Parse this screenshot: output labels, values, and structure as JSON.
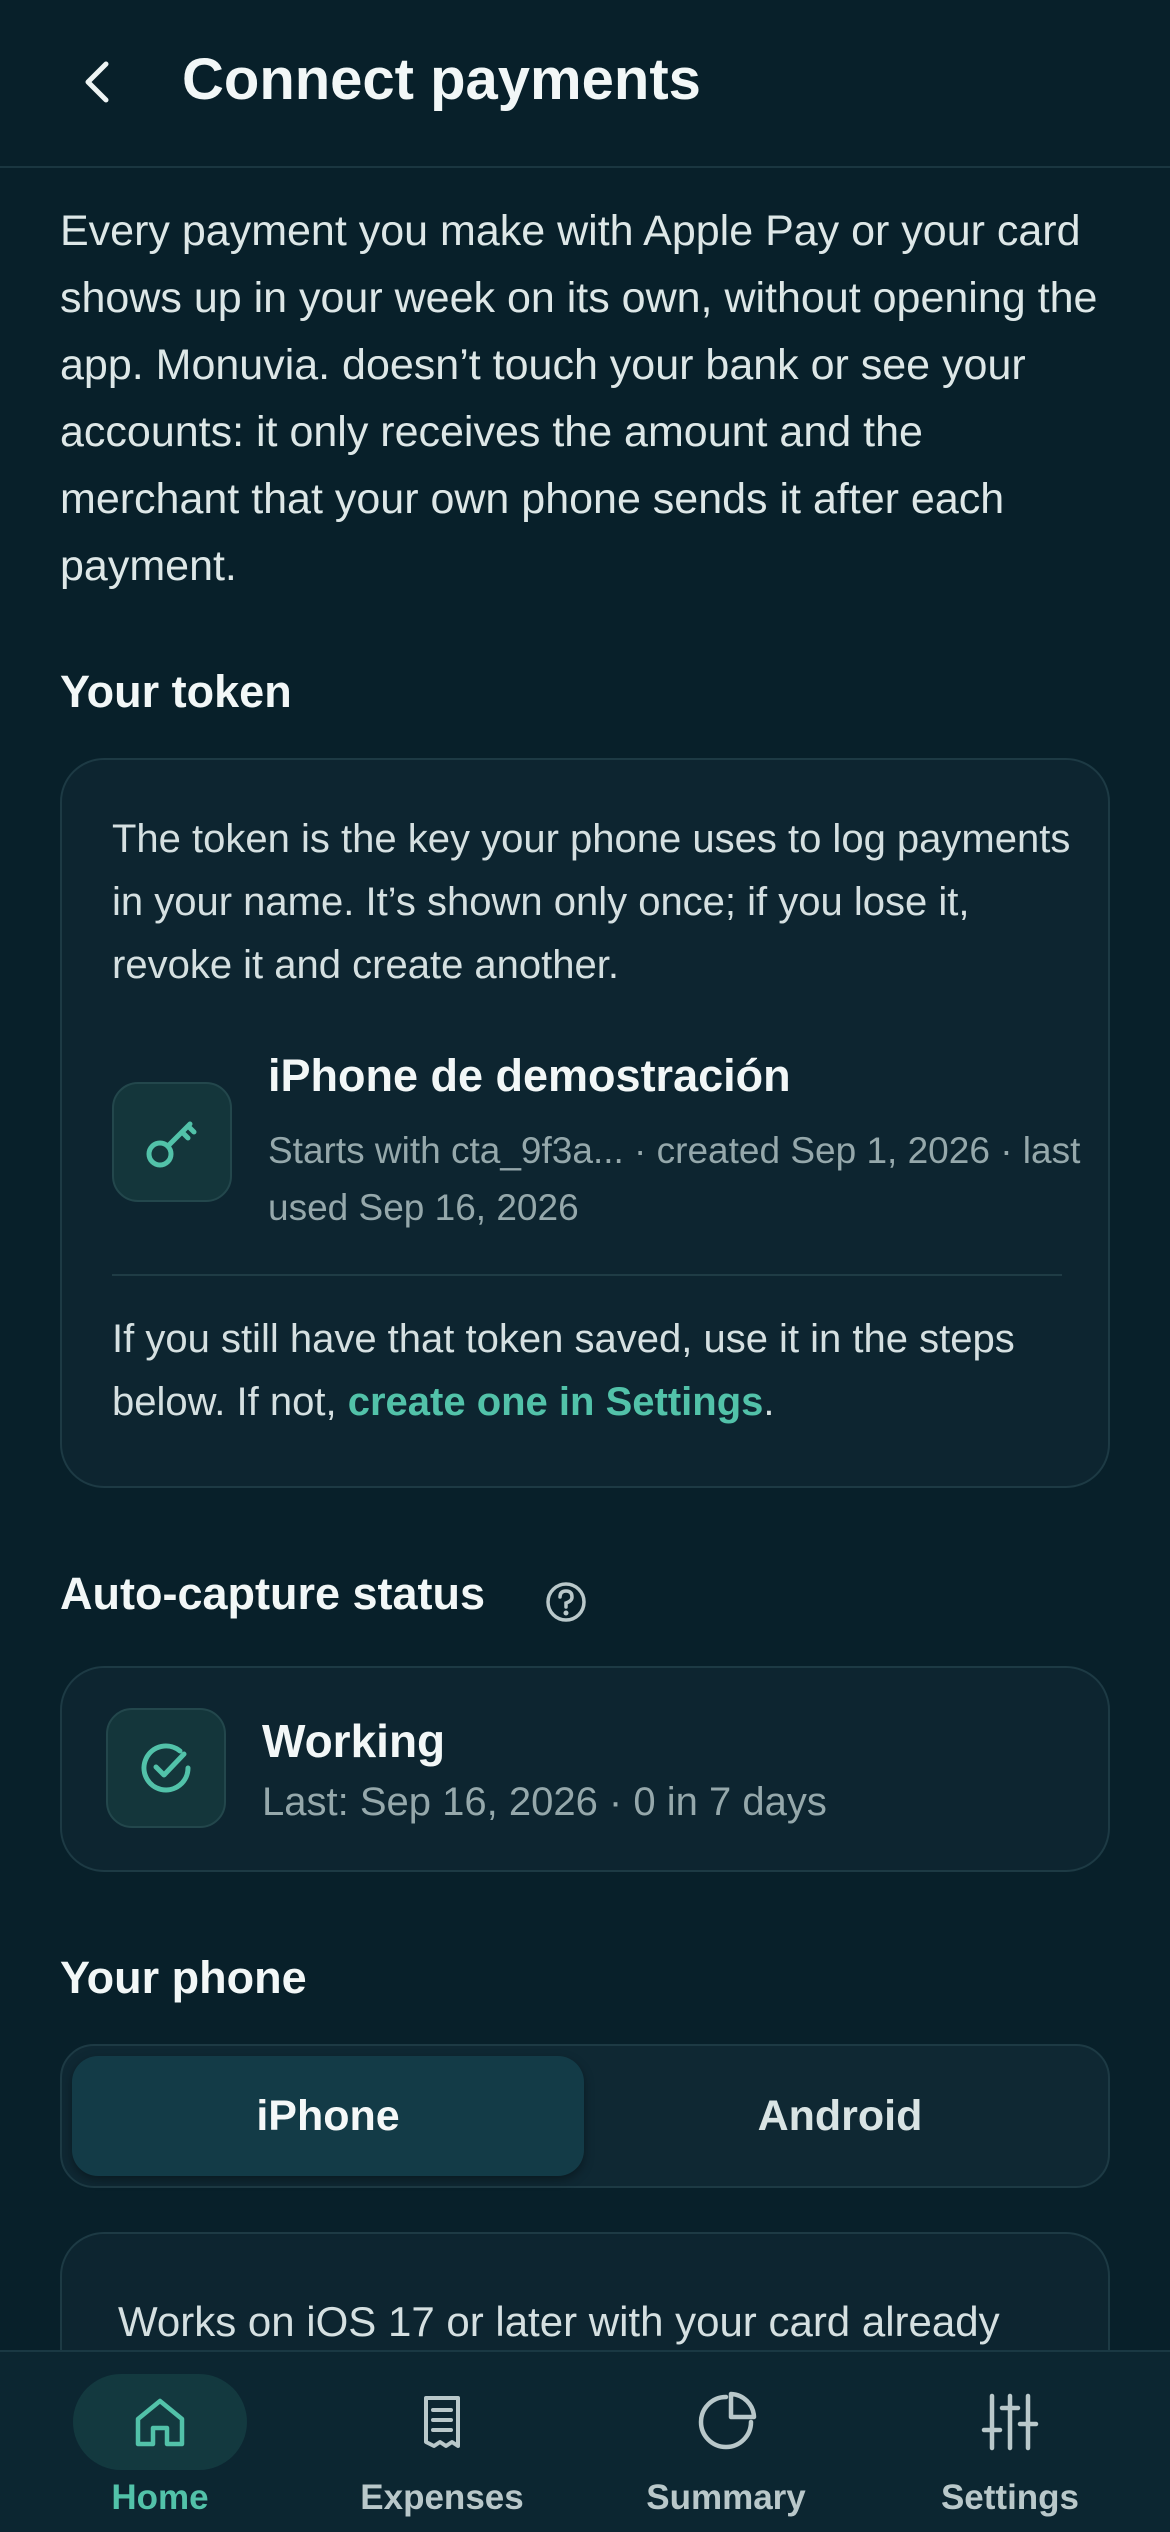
{
  "header": {
    "title": "Connect payments",
    "back_icon": "chevron-left-icon"
  },
  "intro": "Every payment you make with Apple Pay or your card shows up in your week on its own, without opening the app. Monuvia. doesn’t touch your bank or see your accounts: it only receives the amount and the merchant that your own phone sends it after each payment.",
  "token_section": {
    "title": "Your token",
    "description": "The token is the key your phone uses to log payments in your name. It’s shown only once; if you lose it, revoke it and create another.",
    "device": {
      "icon": "key-icon",
      "name": "iPhone de demostración",
      "meta": "Starts with cta_9f3a... · created Sep 1, 2026 · last used Sep 16, 2026"
    },
    "footer_text": "If you still have that token saved, use it in the steps below. If not, ",
    "footer_link": "create one in Settings",
    "footer_end": "."
  },
  "status_section": {
    "title": "Auto-capture status",
    "help_icon": "question-circle-icon",
    "status_icon": "check-circle-icon",
    "status": "Working",
    "meta": "Last: Sep 16, 2026 · 0 in 7 days"
  },
  "phone_section": {
    "title": "Your phone",
    "options": [
      "iPhone",
      "Android"
    ],
    "selected": "iPhone",
    "ios_text": "Works on iOS 17 or later with your card already"
  },
  "tabbar": {
    "items": [
      {
        "label": "Home",
        "icon": "home-icon",
        "active": true
      },
      {
        "label": "Expenses",
        "icon": "receipt-icon",
        "active": false
      },
      {
        "label": "Summary",
        "icon": "pie-chart-icon",
        "active": false
      },
      {
        "label": "Settings",
        "icon": "sliders-icon",
        "active": false
      }
    ]
  },
  "colors": {
    "background": "#08202a",
    "card": "#0d2530",
    "accent": "#52c2a9",
    "muted_text": "#95a8ab"
  }
}
